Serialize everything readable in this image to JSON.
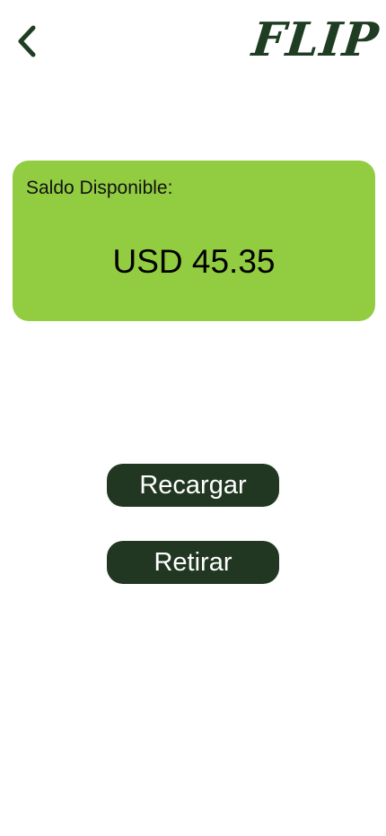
{
  "header": {
    "back_icon": "chevron-left-icon",
    "logo_text": "FLIP",
    "brand_color": "#1f3d22"
  },
  "balance": {
    "label": "Saldo Disponible:",
    "amount": "USD 45.35",
    "card_color": "#92cc41"
  },
  "actions": {
    "recharge_label": "Recargar",
    "withdraw_label": "Retirar",
    "button_color": "#213722"
  }
}
